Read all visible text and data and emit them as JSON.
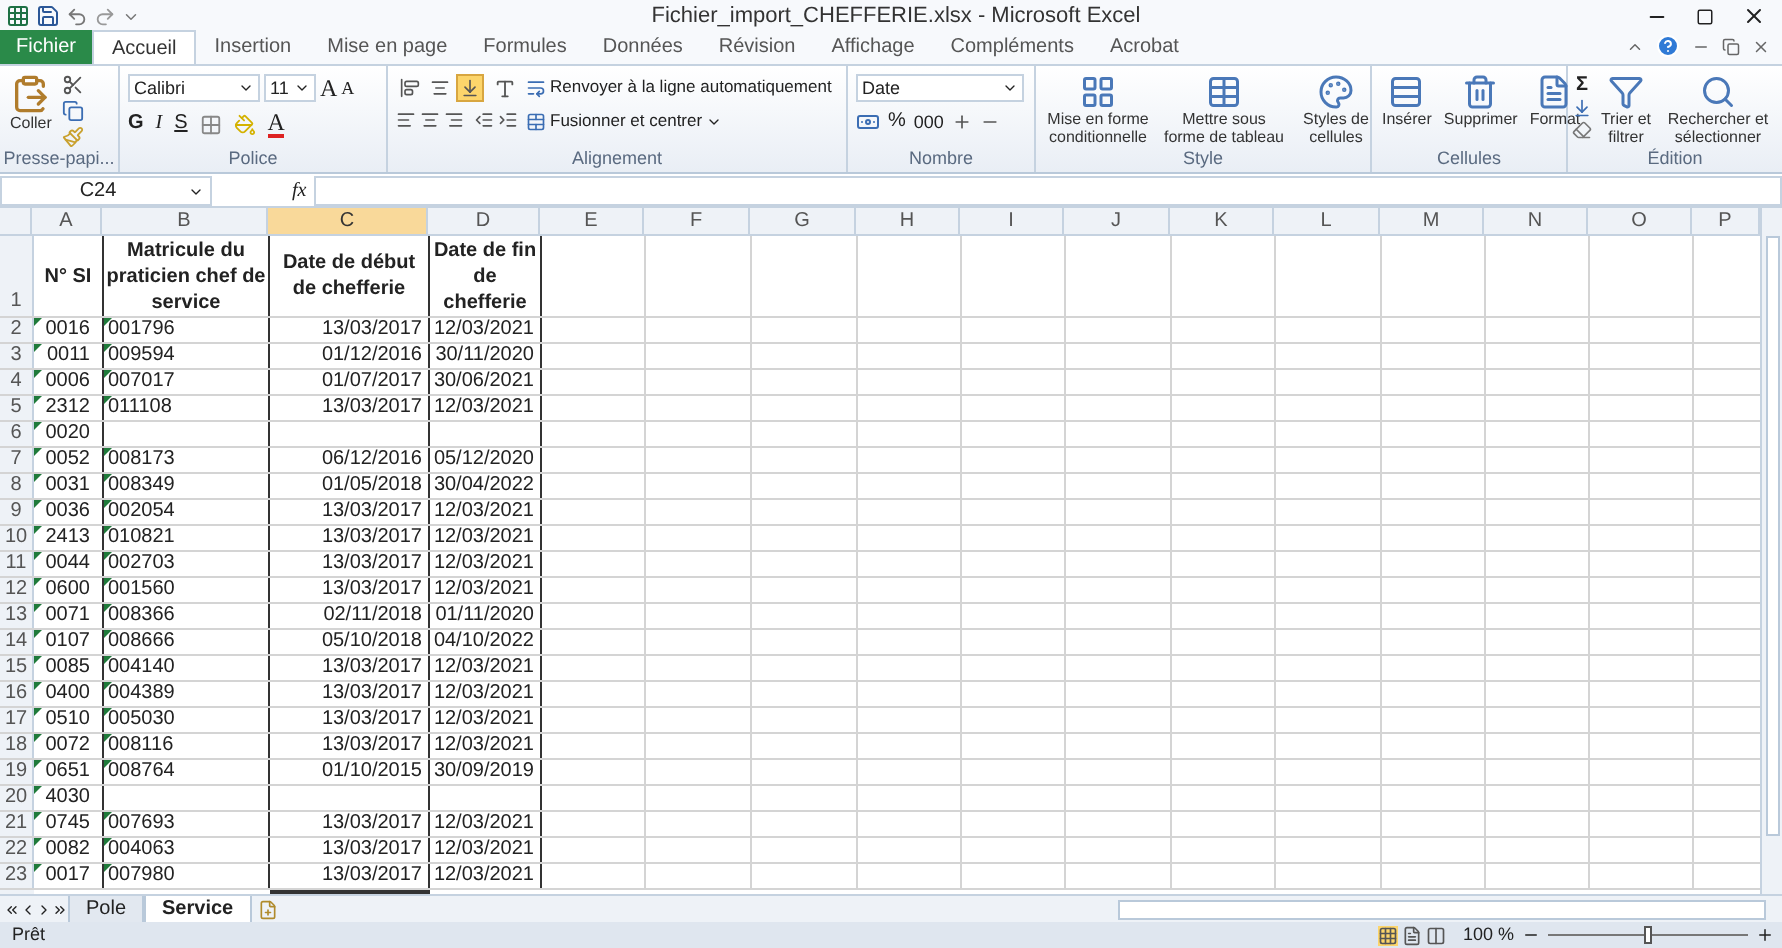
{
  "title_bar": {
    "title": "Fichier_import_CHEFFERIE.xlsx - Microsoft Excel"
  },
  "tabs": [
    {
      "label": "Fichier",
      "kind": "file",
      "selected": false
    },
    {
      "label": "Accueil",
      "kind": "tab",
      "selected": true
    },
    {
      "label": "Insertion",
      "kind": "tab",
      "selected": false
    },
    {
      "label": "Mise en page",
      "kind": "tab",
      "selected": false
    },
    {
      "label": "Formules",
      "kind": "tab",
      "selected": false
    },
    {
      "label": "Données",
      "kind": "tab",
      "selected": false
    },
    {
      "label": "Révision",
      "kind": "tab",
      "selected": false
    },
    {
      "label": "Affichage",
      "kind": "tab",
      "selected": false
    },
    {
      "label": "Compléments",
      "kind": "tab",
      "selected": false
    },
    {
      "label": "Acrobat",
      "kind": "tab",
      "selected": false
    }
  ],
  "ribbon": {
    "clipboard": {
      "label": "Presse-papi...",
      "paste": "Coller"
    },
    "font": {
      "label": "Police",
      "font_name": "Calibri",
      "font_size": "11",
      "grow": "A",
      "shrink": "A",
      "bold": "G",
      "italic": "I",
      "underline": "S",
      "font_color": "A"
    },
    "alignment": {
      "label": "Alignement",
      "vertical_align": [
        {
          "selected": false
        },
        {
          "selected": false
        },
        {
          "selected": true
        }
      ],
      "wrap": "Renvoyer à la ligne automatiquement",
      "merge": "Fusionner et centrer"
    },
    "number": {
      "label": "Nombre",
      "format": "Date",
      "percent": "%",
      "thousands": "000"
    },
    "style": {
      "label": "Style",
      "buttons": [
        "Mise en forme conditionnelle",
        "Mettre sous forme de tableau",
        "Styles de cellules"
      ]
    },
    "cells": {
      "label": "Cellules",
      "buttons": [
        "Insérer",
        "Supprimer",
        "Format"
      ]
    },
    "editing": {
      "label": "Édition",
      "sigma": "Σ",
      "buttons": [
        "Trier et filtrer",
        "Rechercher et sélectionner"
      ]
    }
  },
  "formula_bar": {
    "name_box": "C24",
    "fx": "fx"
  },
  "columns": [
    {
      "label": "A",
      "selected": false
    },
    {
      "label": "B",
      "selected": false
    },
    {
      "label": "C",
      "selected": true
    },
    {
      "label": "D",
      "selected": false
    },
    {
      "label": "E",
      "selected": false
    },
    {
      "label": "F",
      "selected": false
    },
    {
      "label": "G",
      "selected": false
    },
    {
      "label": "H",
      "selected": false
    },
    {
      "label": "I",
      "selected": false
    },
    {
      "label": "J",
      "selected": false
    },
    {
      "label": "K",
      "selected": false
    },
    {
      "label": "L",
      "selected": false
    },
    {
      "label": "M",
      "selected": false
    },
    {
      "label": "N",
      "selected": false
    },
    {
      "label": "O",
      "selected": false
    },
    {
      "label": "P",
      "selected": false
    }
  ],
  "header_row": {
    "row": "1",
    "cells": [
      "N° SI",
      "Matricule du praticien chef de service",
      "Date de début de chefferie",
      "Date de fin de chefferie"
    ]
  },
  "rows": [
    {
      "row": "2",
      "n_si": "0016",
      "matricule": "001796",
      "debut": "13/03/2017",
      "fin": "12/03/2021"
    },
    {
      "row": "3",
      "n_si": "0011",
      "matricule": "009594",
      "debut": "01/12/2016",
      "fin": "30/11/2020"
    },
    {
      "row": "4",
      "n_si": "0006",
      "matricule": "007017",
      "debut": "01/07/2017",
      "fin": "30/06/2021"
    },
    {
      "row": "5",
      "n_si": "2312",
      "matricule": "011108",
      "debut": "13/03/2017",
      "fin": "12/03/2021"
    },
    {
      "row": "6",
      "n_si": "0020"
    },
    {
      "row": "7",
      "n_si": "0052",
      "matricule": "008173",
      "debut": "06/12/2016",
      "fin": "05/12/2020"
    },
    {
      "row": "8",
      "n_si": "0031",
      "matricule": "008349",
      "debut": "01/05/2018",
      "fin": "30/04/2022"
    },
    {
      "row": "9",
      "n_si": "0036",
      "matricule": "002054",
      "debut": "13/03/2017",
      "fin": "12/03/2021"
    },
    {
      "row": "10",
      "n_si": "2413",
      "matricule": "010821",
      "debut": "13/03/2017",
      "fin": "12/03/2021"
    },
    {
      "row": "11",
      "n_si": "0044",
      "matricule": "002703",
      "debut": "13/03/2017",
      "fin": "12/03/2021"
    },
    {
      "row": "12",
      "n_si": "0600",
      "matricule": "001560",
      "debut": "13/03/2017",
      "fin": "12/03/2021"
    },
    {
      "row": "13",
      "n_si": "0071",
      "matricule": "008366",
      "debut": "02/11/2018",
      "fin": "01/11/2020"
    },
    {
      "row": "14",
      "n_si": "0107",
      "matricule": "008666",
      "debut": "05/10/2018",
      "fin": "04/10/2022"
    },
    {
      "row": "15",
      "n_si": "0085",
      "matricule": "004140",
      "debut": "13/03/2017",
      "fin": "12/03/2021"
    },
    {
      "row": "16",
      "n_si": "0400",
      "matricule": "004389",
      "debut": "13/03/2017",
      "fin": "12/03/2021"
    },
    {
      "row": "17",
      "n_si": "0510",
      "matricule": "005030",
      "debut": "13/03/2017",
      "fin": "12/03/2021"
    },
    {
      "row": "18",
      "n_si": "0072",
      "matricule": "008116",
      "debut": "13/03/2017",
      "fin": "12/03/2021"
    },
    {
      "row": "19",
      "n_si": "0651",
      "matricule": "008764",
      "debut": "01/10/2015",
      "fin": "30/09/2019"
    },
    {
      "row": "20",
      "n_si": "4030"
    },
    {
      "row": "21",
      "n_si": "0745",
      "matricule": "007693",
      "debut": "13/03/2017",
      "fin": "12/03/2021"
    },
    {
      "row": "22",
      "n_si": "0082",
      "matricule": "004063",
      "debut": "13/03/2017",
      "fin": "12/03/2021"
    },
    {
      "row": "23",
      "n_si": "0017",
      "matricule": "007980",
      "debut": "13/03/2017",
      "fin": "12/03/2021"
    }
  ],
  "sheet_tabs": [
    {
      "label": "Pole",
      "selected": false
    },
    {
      "label": "Service",
      "selected": true
    }
  ],
  "status_bar": {
    "text": "Prêt",
    "zoom": "100 %",
    "zoom_slider": {
      "level": 0.5
    }
  }
}
